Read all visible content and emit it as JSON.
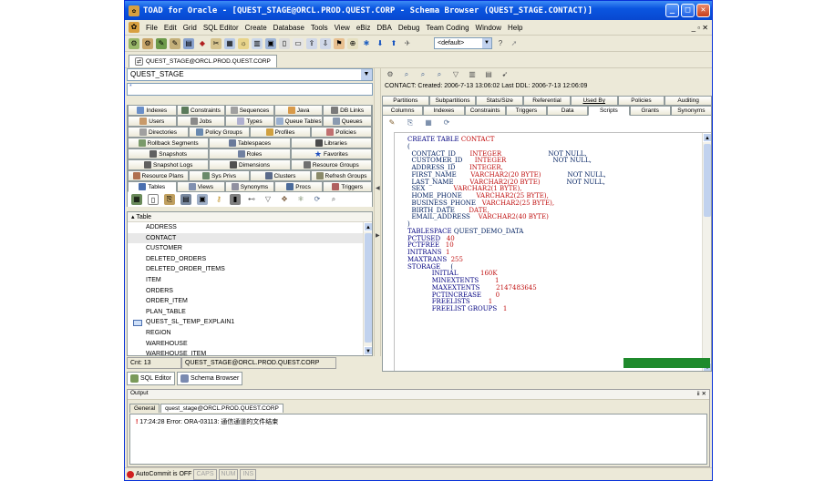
{
  "window": {
    "title": "TOAD for Oracle - [QUEST_STAGE@ORCL.PROD.QUEST.CORP - Schema Browser (QUEST_STAGE.CONTACT)]"
  },
  "menu": {
    "items": [
      "File",
      "Edit",
      "Grid",
      "SQL Editor",
      "Create",
      "Database",
      "Tools",
      "View",
      "eBiz",
      "DBA",
      "Debug",
      "Team Coding",
      "Window",
      "Help"
    ],
    "mdi_controls": "_ ▫ ✕"
  },
  "toolbar": {
    "default_combo": "<default>"
  },
  "connection_tab": {
    "label": "QUEST_STAGE@ORCL.PROD.QUEST.CORP"
  },
  "schema": {
    "selected": "QUEST_STAGE",
    "filter": "*"
  },
  "object_tabs": {
    "rows": [
      [
        "Indexes",
        "Constraints",
        "Sequences",
        "Java",
        "DB Links"
      ],
      [
        "Users",
        "Jobs",
        "Types",
        "Queue Tables",
        "Queues"
      ],
      [
        "Directories",
        "Policy Groups",
        "Profiles",
        "Policies"
      ],
      [
        "Rollback Segments",
        "Tablespaces",
        "Libraries"
      ],
      [
        "Snapshots",
        "Roles",
        "Favorites"
      ],
      [
        "Snapshot Logs",
        "Dimensions",
        "Resource Groups"
      ],
      [
        "Resource Plans",
        "Sys Privs",
        "Clusters",
        "Refresh Groups"
      ],
      [
        "Tables",
        "Views",
        "Synonyms",
        "Procs",
        "Triggers"
      ]
    ],
    "active": "Tables"
  },
  "table_list": {
    "header": "Table",
    "items": [
      "ADDRESS",
      "CONTACT",
      "CUSTOMER",
      "DELETED_ORDERS",
      "DELETED_ORDER_ITEMS",
      "ITEM",
      "ORDERS",
      "ORDER_ITEM",
      "PLAN_TABLE",
      "QUEST_SL_TEMP_EXPLAIN1",
      "REGION",
      "WAREHOUSE",
      "WAREHOUSE_ITEM"
    ],
    "selected": "CONTACT"
  },
  "detail": {
    "info": "CONTACT:  Created: 2006-7-13 13:06:02  Last DDL: 2006-7-13 12:06:09",
    "tabs_row1": [
      "Partitions",
      "Subpartitions",
      "Stats/Size",
      "Referential",
      "Used By",
      "Policies",
      "Auditing"
    ],
    "tabs_row2": [
      "Columns",
      "Indexes",
      "Constraints",
      "Triggers",
      "Data",
      "Scripts",
      "Grants",
      "Synonyms"
    ],
    "active_tab": "Scripts"
  },
  "script": {
    "create_kw": "CREATE TABLE",
    "table_name": "CONTACT",
    "open_paren": "(",
    "columns": [
      {
        "name": "CONTACT_ID",
        "type": "INTEGER",
        "null": "NOT NULL,"
      },
      {
        "name": "CUSTOMER_ID",
        "type": "INTEGER",
        "null": "NOT NULL,"
      },
      {
        "name": "ADDRESS_ID",
        "type": "INTEGER,",
        "null": ""
      },
      {
        "name": "FIRST_NAME",
        "type": "VARCHAR2(20 BYTE)",
        "null": "NOT NULL,"
      },
      {
        "name": "LAST_NAME",
        "type": "VARCHAR2(20 BYTE)",
        "null": "NOT NULL,"
      },
      {
        "name": "SEX",
        "type": "VARCHAR2(1 BYTE),",
        "null": ""
      },
      {
        "name": "HOME_PHONE",
        "type": "VARCHAR2(25 BYTE),",
        "null": ""
      },
      {
        "name": "BUSINESS_PHONE",
        "type": "VARCHAR2(25 BYTE),",
        "null": ""
      },
      {
        "name": "BIRTH_DATE",
        "type": "DATE,",
        "null": ""
      },
      {
        "name": "EMAIL_ADDRESS",
        "type": "VARCHAR2(40 BYTE)",
        "null": ""
      }
    ],
    "close_paren": ")",
    "tablespace": {
      "kw": "TABLESPACE",
      "value": "QUEST_DEMO_DATA"
    },
    "params": [
      {
        "kw": "PCTUSED",
        "value": "40"
      },
      {
        "kw": "PCTFREE",
        "value": "10"
      },
      {
        "kw": "INITRANS",
        "value": "1"
      },
      {
        "kw": "MAXTRANS",
        "value": "255"
      }
    ],
    "storage_kw": "STORAGE",
    "storage_open": "(",
    "storage": [
      {
        "kw": "INITIAL",
        "value": "160K"
      },
      {
        "kw": "MINEXTENTS",
        "value": "1"
      },
      {
        "kw": "MAXEXTENTS",
        "value": "2147483645"
      },
      {
        "kw": "PCTINCREASE",
        "value": "0"
      },
      {
        "kw": "FREELISTS",
        "value": "1"
      },
      {
        "kw": "FREELIST GROUPS",
        "value": "1"
      }
    ]
  },
  "status": {
    "count": "Cnt: 13",
    "connection": "QUEST_STAGE@ORCL.PROD.QUEST.CORP",
    "progress": 1.0,
    "progress_color": "#1f8a2c"
  },
  "window_buttons": [
    "SQL Editor",
    "Schema Browser"
  ],
  "output": {
    "title": "Output",
    "controls": "ⅱ ✕",
    "tabs": [
      "General",
      "quest_stage@ORCL.PROD.QUEST.CORP"
    ],
    "active_tab": "quest_stage@ORCL.PROD.QUEST.CORP",
    "message": "17:24:28 Error: ORA-03113: 通信通道的文件结束"
  },
  "statusbar": {
    "autocommit": "AutoCommit is OFF",
    "caps": "CAPS",
    "num": "NUM",
    "ins": "INS"
  },
  "colors": {
    "accent": "#0a55e0",
    "keyword": "#000080",
    "type": "#c01010"
  }
}
